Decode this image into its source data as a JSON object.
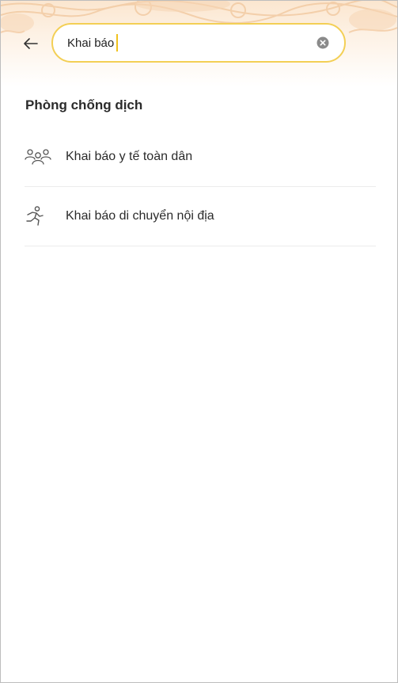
{
  "search": {
    "back_icon": "arrow-left-icon",
    "query": "Khai báo",
    "clear_icon": "clear-circle-icon",
    "focus_color": "#f3cf55",
    "caret_color": "#f0c21e"
  },
  "section": {
    "title": "Phòng chống dịch"
  },
  "results": [
    {
      "icon": "people-group-icon",
      "label": "Khai báo y tế toàn dân"
    },
    {
      "icon": "running-person-icon",
      "label": "Khai báo di chuyển nội địa"
    }
  ]
}
